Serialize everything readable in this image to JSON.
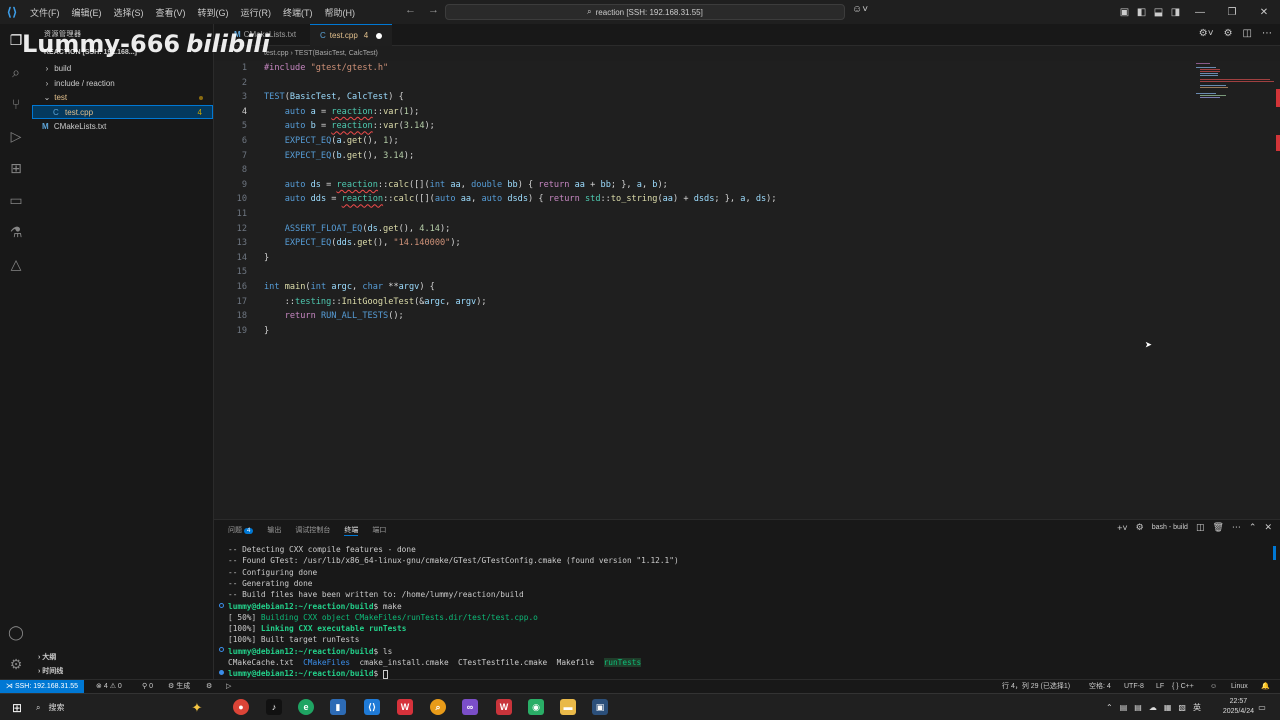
{
  "titlebar": {
    "menu": [
      "文件(F)",
      "编辑(E)",
      "选择(S)",
      "查看(V)",
      "转到(G)",
      "运行(R)",
      "终端(T)",
      "帮助(H)"
    ],
    "search_text": "reaction [SSH: 192.168.31.55]"
  },
  "watermark": {
    "text": "Lummy-666",
    "brand": "bilibili"
  },
  "sidebar": {
    "title": "资源管理器",
    "root": "REACTION [SSH: 192.168...]",
    "items": [
      {
        "label": "build",
        "chev": "›"
      },
      {
        "label": "include / reaction",
        "chev": "›"
      },
      {
        "label": "test",
        "chev": "⌄"
      },
      {
        "label": "test.cpp",
        "badge": "4"
      },
      {
        "label": "CMakeLists.txt",
        "icon": "M"
      }
    ],
    "footer": [
      "大纲",
      "时间线"
    ]
  },
  "tabs": {
    "items": [
      {
        "label": "CMakeLists.txt"
      },
      {
        "label": "test.cpp",
        "badge": "4"
      }
    ]
  },
  "breadcrumb": {
    "file": "test.cpp",
    "symbol": "TEST(BasicTest, CalcTest)"
  },
  "editor": {
    "line_numbers": [
      "1",
      "2",
      "3",
      "4",
      "5",
      "6",
      "7",
      "8",
      "9",
      "10",
      "11",
      "12",
      "13",
      "14",
      "15",
      "16",
      "17",
      "18",
      "19"
    ],
    "current_line": 4
  },
  "panel": {
    "tabs": [
      "问题",
      "输出",
      "调试控制台",
      "终端",
      "端口"
    ],
    "problems_count": "4",
    "terminal_name": "bash - build",
    "lines": [
      "-- Detecting CXX compile features - done",
      "-- Found GTest: /usr/lib/x86_64-linux-gnu/cmake/GTest/GTestConfig.cmake (found version \"1.12.1\")",
      "-- Configuring done",
      "-- Generating done",
      "-- Build files have been written to: /home/lummy/reaction/build"
    ],
    "prompt": "lummy@debian12:~/reaction/build",
    "cmd_make": "make",
    "build_lines": [
      {
        "pct": "[ 50%]",
        "text": "Building CXX object CMakeFiles/runTests.dir/test/test.cpp.o"
      },
      {
        "pct": "[100%]",
        "text": "Linking CXX executable runTests"
      },
      {
        "pct": "[100%]",
        "text": "Built target runTests"
      }
    ],
    "cmd_ls": "ls",
    "ls_output": [
      "CMakeCache.txt",
      "CMakeFiles",
      "cmake_install.cmake",
      "CTestTestfile.cmake",
      "Makefile",
      "runTests"
    ]
  },
  "statusbar": {
    "remote": "SSH: 192.168.31.55",
    "errors": "4",
    "warnings": "0",
    "ports": "0",
    "build": "生成",
    "position": "行 4，列 29 (已选择1)",
    "spaces": "空格: 4",
    "encoding": "UTF-8",
    "eol": "LF",
    "language": "{ } C++",
    "os": "Linux"
  },
  "taskbar": {
    "search": "搜索",
    "ime": "英",
    "time": "22:57",
    "date": "2025/4/24"
  },
  "colors": {
    "accent": "#0078d4",
    "error": "#f14c4c",
    "warning": "#cca700"
  }
}
